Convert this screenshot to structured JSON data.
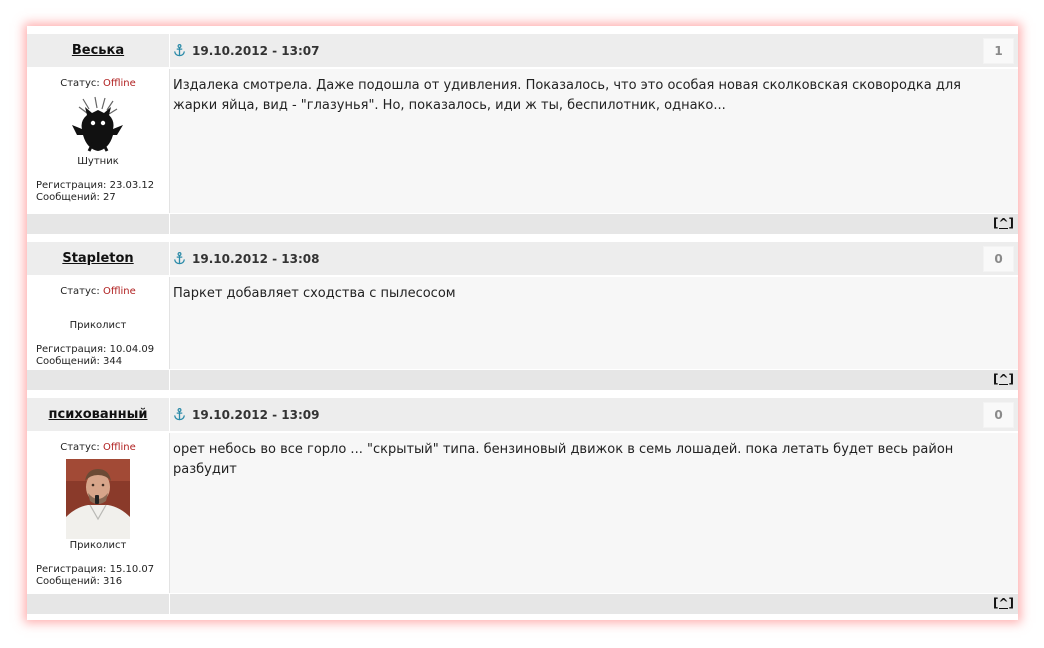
{
  "posts": [
    {
      "author": "Веська",
      "datetime": "19.10.2012 - 13:07",
      "number": "1",
      "status_label": "Статус:",
      "status": "Offline",
      "rank": "Шутник",
      "registration": "Регистрация: 23.03.12",
      "messages": "Сообщений: 27",
      "text": "Издалека смотрела. Даже подошла от удивления. Показалось, что это особая новая сколковская сковородка для жарки яйца, вид - \"глазунья\". Но, показалось, иди ж ты, беспилотник, однако...",
      "top_link": "[^]",
      "avatar": "black-cat-avatar"
    },
    {
      "author": "Stapleton",
      "datetime": "19.10.2012 - 13:08",
      "number": "0",
      "status_label": "Статус:",
      "status": "Offline",
      "rank": "Приколист",
      "registration": "Регистрация: 10.04.09",
      "messages": "Сообщений: 344",
      "text": "Паркет добавляет сходства с пылесосом",
      "top_link": "[^]",
      "avatar": "none"
    },
    {
      "author": "психованный",
      "datetime": "19.10.2012 - 13:09",
      "number": "0",
      "status_label": "Статус:",
      "status": "Offline",
      "rank": "Приколист",
      "registration": "Регистрация: 15.10.07",
      "messages": "Сообщений: 316",
      "text": "орет небось во все горло ... \"скрытый\" типа. бензиновый движок в семь лошадей. пока летать будет весь район разбудит",
      "top_link": "[^]",
      "avatar": "man-photo-avatar"
    }
  ],
  "colors": {
    "header_bg": "#ededed",
    "message_bg": "#f7f7f7",
    "footer_bg": "#e6e6e6",
    "offline": "#b02020",
    "anchor": "#2a8aa8",
    "frame_glow": "#ff6e6e"
  },
  "icons": {
    "post_link": "anchor-icon"
  }
}
